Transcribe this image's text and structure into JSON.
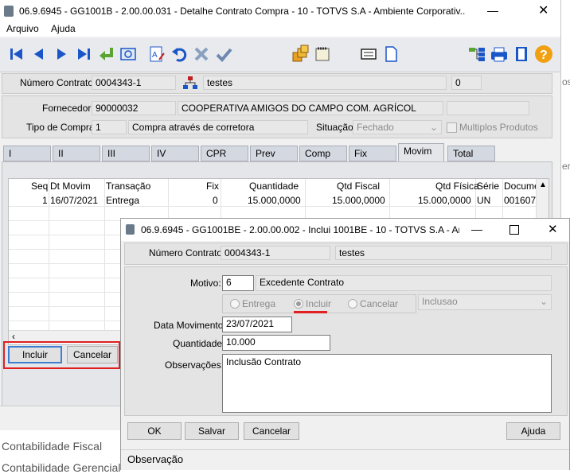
{
  "main_window": {
    "title": "06.9.6945 - GG1001B - 2.00.00.031 - Detalhe Contrato Compra - 10 - TOTVS S.A - Ambiente Corporativ...",
    "menu": [
      "Arquivo",
      "Ajuda"
    ],
    "header": {
      "numero_contrato_label": "Número Contrato:",
      "numero_contrato": "0004343-1",
      "descricao": "testes",
      "contador": "0"
    },
    "fornecedor": {
      "fornecedor_label": "Fornecedor:",
      "codigo": "90000032",
      "nome": "COOPERATIVA AMIGOS DO CAMPO COM. AGRÍCOL",
      "tipo_compra_label": "Tipo de Compra:",
      "tipo_compra_codigo": "1",
      "tipo_compra_desc": "Compra através de corretora",
      "situacao_label": "Situação:",
      "situacao": "Fechado",
      "multiplos_label": "Multiplos Produtos"
    },
    "tabs": [
      "I",
      "II",
      "III",
      "IV",
      "CPR",
      "Prev",
      "Comp",
      "Fix",
      "Movim",
      "Total"
    ],
    "active_tab": "Movim",
    "grid": {
      "columns": [
        "Seq",
        "Dt Movim",
        "Transação",
        "Fix",
        "Quantidade",
        "Qtd Fiscal",
        "Qtd Física",
        "Série",
        "Documen"
      ],
      "rows": [
        [
          "1",
          "16/07/2021",
          "Entrega",
          "0",
          "15.000,0000",
          "15.000,0000",
          "15.000,0000",
          "UN",
          "001607"
        ]
      ]
    },
    "buttons": {
      "incluir": "Incluir",
      "cancelar": "Cancelar"
    }
  },
  "background": {
    "contabilidade_fiscal": "Contabilidade Fiscal",
    "contabilidade_gerencial": "Contabilidade Gerencial",
    "edge_text_1": "os",
    "edge_text_2": "er"
  },
  "dialog": {
    "title": "06.9.6945 - GG1001BE - 2.00.00.002 - Inclui 1001BE - 10 - TOTVS S.A - Ambi...",
    "numero_contrato_label": "Número Contrato:",
    "numero_contrato": "0004343-1",
    "descricao": "testes",
    "motivo_label": "Motivo:",
    "motivo_codigo": "6",
    "motivo_desc": "Excedente Contrato",
    "radios": [
      "Entrega",
      "Incluir",
      "Cancelar"
    ],
    "radio_selected": "Incluir",
    "tipo_select": "Inclusao",
    "data_movimento_label": "Data Movimento:",
    "data_movimento": "23/07/2021",
    "quantidade_label": "Quantidade:",
    "quantidade": "10.000",
    "observacoes_label": "Observações:",
    "observacoes": "Inclusão Contrato",
    "buttons": {
      "ok": "OK",
      "salvar": "Salvar",
      "cancelar": "Cancelar",
      "ajuda": "Ajuda"
    },
    "status": "Observação"
  },
  "colors": {
    "highlight_red": "#e02020",
    "toolbar_blue": "#1a56c8",
    "accent_arrow": "#5aa532"
  }
}
